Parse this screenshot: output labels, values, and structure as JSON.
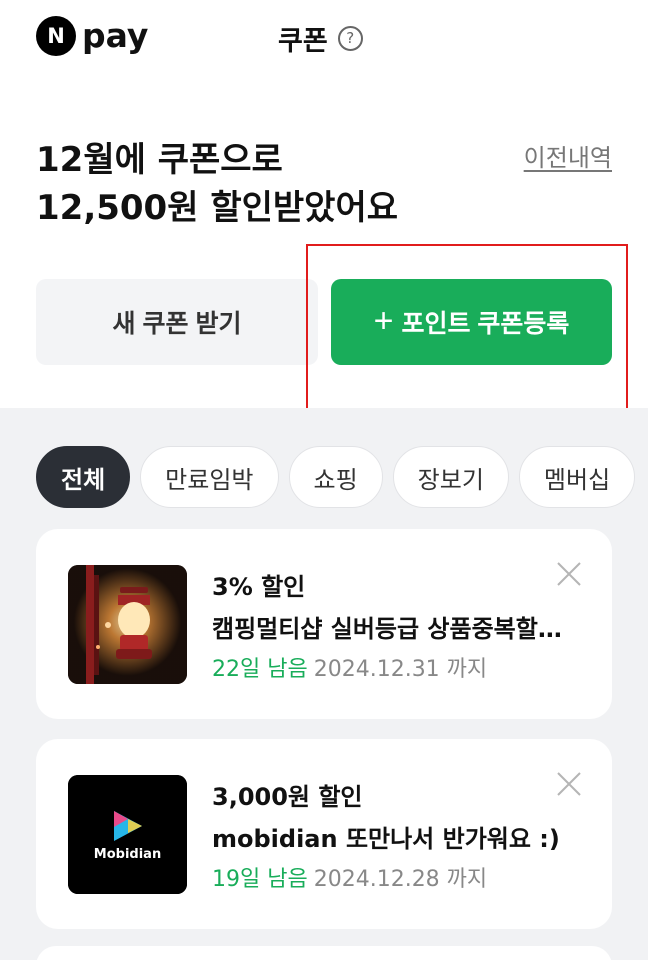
{
  "header": {
    "logo_letter": "N",
    "logo_text": "pay",
    "title": "쿠폰",
    "help_glyph": "?"
  },
  "summary": {
    "line1": "12월에 쿠폰으로",
    "line2": "12,500원 할인받았어요",
    "history_link": "이전내역"
  },
  "actions": {
    "new_coupon": "새 쿠폰 받기",
    "register_plus": "+",
    "register": "포인트 쿠폰등록"
  },
  "filters": [
    "전체",
    "만료임박",
    "쇼핑",
    "장보기",
    "멤버십"
  ],
  "coupons": [
    {
      "discount": "3% 할인",
      "name": "캠핑멀티샵 실버등급 상품중복할인쿠폰",
      "remaining": "22일 남음",
      "expiry": "2024.12.31 까지",
      "thumb_icon": "lantern-icon"
    },
    {
      "discount": "3,000원 할인",
      "name": "mobidian 또만나서 반가워요 :)",
      "remaining": "19일 남음",
      "expiry": "2024.12.28 까지",
      "thumb_icon": "mobidian-logo-icon",
      "brand": "Mobidian"
    }
  ],
  "colors": {
    "accent_green": "#19ad5a",
    "highlight_red": "#e11c1c",
    "chip_active": "#2b2f36"
  }
}
